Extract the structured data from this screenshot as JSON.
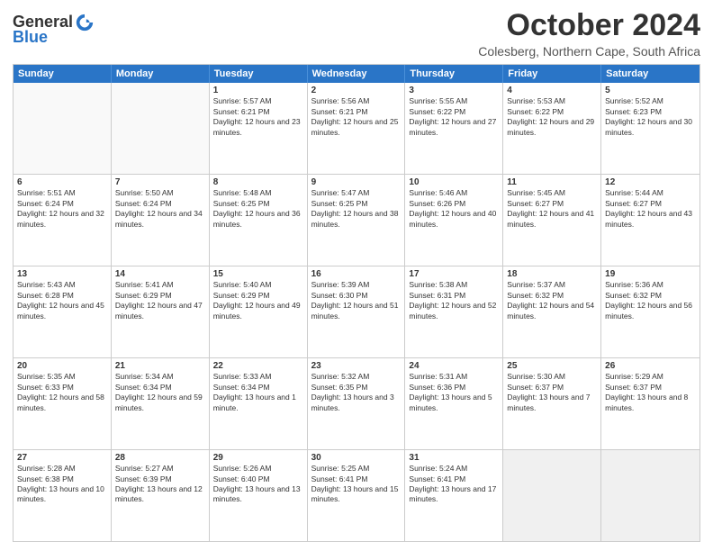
{
  "logo": {
    "line1": "General",
    "line2": "Blue",
    "icon": "▶"
  },
  "title": "October 2024",
  "location": "Colesberg, Northern Cape, South Africa",
  "days_of_week": [
    "Sunday",
    "Monday",
    "Tuesday",
    "Wednesday",
    "Thursday",
    "Friday",
    "Saturday"
  ],
  "weeks": [
    [
      {
        "day": "",
        "empty": true
      },
      {
        "day": "",
        "empty": true
      },
      {
        "day": "1",
        "sunrise": "5:57 AM",
        "sunset": "6:21 PM",
        "daylight": "12 hours and 23 minutes."
      },
      {
        "day": "2",
        "sunrise": "5:56 AM",
        "sunset": "6:21 PM",
        "daylight": "12 hours and 25 minutes."
      },
      {
        "day": "3",
        "sunrise": "5:55 AM",
        "sunset": "6:22 PM",
        "daylight": "12 hours and 27 minutes."
      },
      {
        "day": "4",
        "sunrise": "5:53 AM",
        "sunset": "6:22 PM",
        "daylight": "12 hours and 29 minutes."
      },
      {
        "day": "5",
        "sunrise": "5:52 AM",
        "sunset": "6:23 PM",
        "daylight": "12 hours and 30 minutes."
      }
    ],
    [
      {
        "day": "6",
        "sunrise": "5:51 AM",
        "sunset": "6:24 PM",
        "daylight": "12 hours and 32 minutes."
      },
      {
        "day": "7",
        "sunrise": "5:50 AM",
        "sunset": "6:24 PM",
        "daylight": "12 hours and 34 minutes."
      },
      {
        "day": "8",
        "sunrise": "5:48 AM",
        "sunset": "6:25 PM",
        "daylight": "12 hours and 36 minutes."
      },
      {
        "day": "9",
        "sunrise": "5:47 AM",
        "sunset": "6:25 PM",
        "daylight": "12 hours and 38 minutes."
      },
      {
        "day": "10",
        "sunrise": "5:46 AM",
        "sunset": "6:26 PM",
        "daylight": "12 hours and 40 minutes."
      },
      {
        "day": "11",
        "sunrise": "5:45 AM",
        "sunset": "6:27 PM",
        "daylight": "12 hours and 41 minutes."
      },
      {
        "day": "12",
        "sunrise": "5:44 AM",
        "sunset": "6:27 PM",
        "daylight": "12 hours and 43 minutes."
      }
    ],
    [
      {
        "day": "13",
        "sunrise": "5:43 AM",
        "sunset": "6:28 PM",
        "daylight": "12 hours and 45 minutes."
      },
      {
        "day": "14",
        "sunrise": "5:41 AM",
        "sunset": "6:29 PM",
        "daylight": "12 hours and 47 minutes."
      },
      {
        "day": "15",
        "sunrise": "5:40 AM",
        "sunset": "6:29 PM",
        "daylight": "12 hours and 49 minutes."
      },
      {
        "day": "16",
        "sunrise": "5:39 AM",
        "sunset": "6:30 PM",
        "daylight": "12 hours and 51 minutes."
      },
      {
        "day": "17",
        "sunrise": "5:38 AM",
        "sunset": "6:31 PM",
        "daylight": "12 hours and 52 minutes."
      },
      {
        "day": "18",
        "sunrise": "5:37 AM",
        "sunset": "6:32 PM",
        "daylight": "12 hours and 54 minutes."
      },
      {
        "day": "19",
        "sunrise": "5:36 AM",
        "sunset": "6:32 PM",
        "daylight": "12 hours and 56 minutes."
      }
    ],
    [
      {
        "day": "20",
        "sunrise": "5:35 AM",
        "sunset": "6:33 PM",
        "daylight": "12 hours and 58 minutes."
      },
      {
        "day": "21",
        "sunrise": "5:34 AM",
        "sunset": "6:34 PM",
        "daylight": "12 hours and 59 minutes."
      },
      {
        "day": "22",
        "sunrise": "5:33 AM",
        "sunset": "6:34 PM",
        "daylight": "13 hours and 1 minute."
      },
      {
        "day": "23",
        "sunrise": "5:32 AM",
        "sunset": "6:35 PM",
        "daylight": "13 hours and 3 minutes."
      },
      {
        "day": "24",
        "sunrise": "5:31 AM",
        "sunset": "6:36 PM",
        "daylight": "13 hours and 5 minutes."
      },
      {
        "day": "25",
        "sunrise": "5:30 AM",
        "sunset": "6:37 PM",
        "daylight": "13 hours and 7 minutes."
      },
      {
        "day": "26",
        "sunrise": "5:29 AM",
        "sunset": "6:37 PM",
        "daylight": "13 hours and 8 minutes."
      }
    ],
    [
      {
        "day": "27",
        "sunrise": "5:28 AM",
        "sunset": "6:38 PM",
        "daylight": "13 hours and 10 minutes."
      },
      {
        "day": "28",
        "sunrise": "5:27 AM",
        "sunset": "6:39 PM",
        "daylight": "13 hours and 12 minutes."
      },
      {
        "day": "29",
        "sunrise": "5:26 AM",
        "sunset": "6:40 PM",
        "daylight": "13 hours and 13 minutes."
      },
      {
        "day": "30",
        "sunrise": "5:25 AM",
        "sunset": "6:41 PM",
        "daylight": "13 hours and 15 minutes."
      },
      {
        "day": "31",
        "sunrise": "5:24 AM",
        "sunset": "6:41 PM",
        "daylight": "13 hours and 17 minutes."
      },
      {
        "day": "",
        "empty": true
      },
      {
        "day": "",
        "empty": true
      }
    ]
  ]
}
